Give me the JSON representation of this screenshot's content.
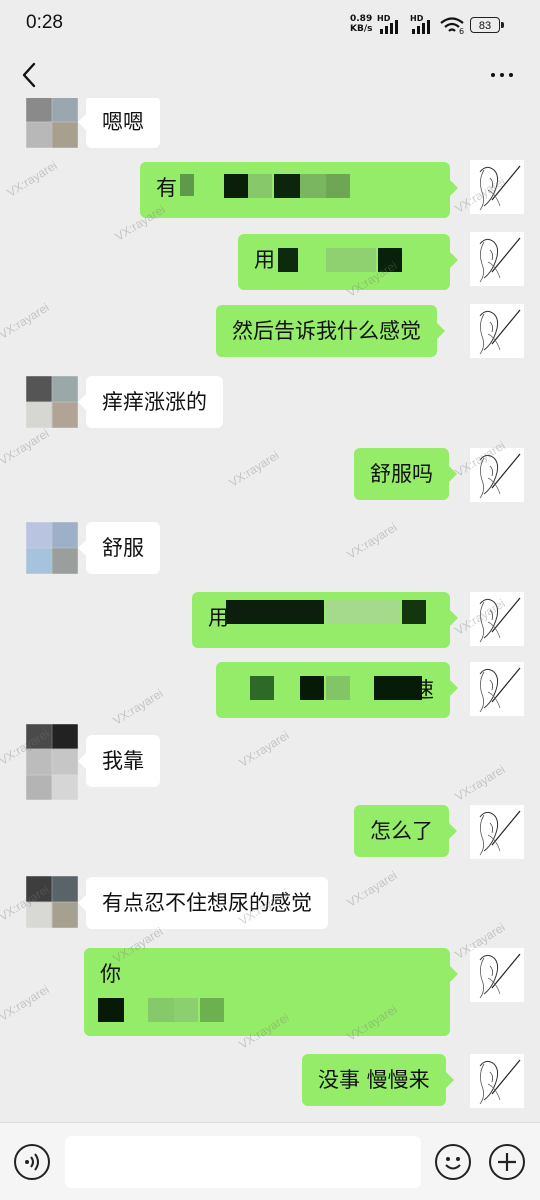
{
  "status_bar": {
    "time": "0:28",
    "net_speed_value": "0.89",
    "net_speed_unit": "KB/s",
    "hd_label_1": "HD",
    "hd_label_2": "HD",
    "wifi_sub": "6",
    "battery": "83"
  },
  "nav": {
    "back_icon": "chevron-left-icon",
    "more_icon": "more-dots-icon"
  },
  "messages": [
    {
      "side": "in",
      "text": "嗯嗯"
    },
    {
      "side": "out",
      "text": "有",
      "redacted": true
    },
    {
      "side": "out",
      "text": "用",
      "redacted": true
    },
    {
      "side": "out",
      "text": "然后告诉我什么感觉"
    },
    {
      "side": "in",
      "text": "痒痒涨涨的"
    },
    {
      "side": "out",
      "text": "舒服吗"
    },
    {
      "side": "in",
      "text": "舒服"
    },
    {
      "side": "out",
      "text": "用",
      "redacted": true
    },
    {
      "side": "out",
      "text": "速",
      "redacted": true
    },
    {
      "side": "in",
      "text": "我靠"
    },
    {
      "side": "out",
      "text": "怎么了"
    },
    {
      "side": "in",
      "text": "有点忍不住想尿的感觉"
    },
    {
      "side": "out",
      "text": "你",
      "redacted": true
    },
    {
      "side": "out",
      "text": "没事 慢慢来"
    }
  ],
  "watermark": "VX:rayarei",
  "input_bar": {
    "voice_icon": "voice-icon",
    "input_value": "",
    "emoji_icon": "emoji-icon",
    "add_icon": "plus-icon"
  },
  "colors": {
    "outgoing_bubble": "#95ec69",
    "incoming_bubble": "#ffffff",
    "background": "#ededed"
  }
}
